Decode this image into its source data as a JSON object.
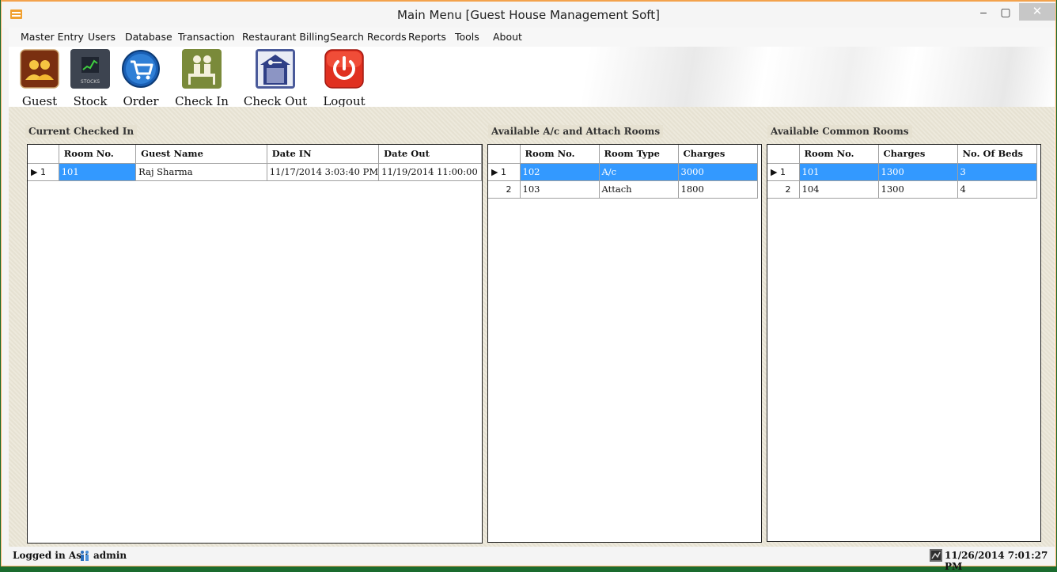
{
  "window": {
    "title": "Main Menu [Guest House Management Soft]",
    "controls": {
      "minimize": "‒",
      "maximize": "▢",
      "close": "✕"
    }
  },
  "menu": [
    "Master Entry",
    "Users",
    "Database",
    "Transaction",
    "Restaurant Billing",
    "Search Records",
    "Reports",
    "Tools",
    "About"
  ],
  "toolbar": {
    "guest": "Guest",
    "stock": "Stock",
    "stock_icon_text": "STOCKS",
    "order": "Order",
    "check_in": "Check In",
    "check_out": "Check Out",
    "logout": "Logout"
  },
  "checked_in": {
    "label": "Current Checked In",
    "columns": [
      "Room No.",
      "Guest Name",
      "Date IN",
      "Date Out"
    ],
    "rows": [
      {
        "num": "1",
        "marker": "▶",
        "cells": [
          "101",
          "Raj Sharma",
          "11/17/2014 3:03:40 PM",
          "11/19/2014 11:00:00"
        ]
      }
    ]
  },
  "ac_rooms": {
    "label": "Available A/c and Attach Rooms",
    "columns": [
      "Room No.",
      "Room Type",
      "Charges"
    ],
    "rows": [
      {
        "num": "1",
        "marker": "▶",
        "cells": [
          "102",
          "A/c",
          "3000"
        ]
      },
      {
        "num": "2",
        "marker": "",
        "cells": [
          "103",
          "Attach",
          "1800"
        ]
      }
    ]
  },
  "common_rooms": {
    "label": "Available Common Rooms",
    "columns": [
      "Room No.",
      "Charges",
      "No. Of Beds"
    ],
    "rows": [
      {
        "num": "1",
        "marker": "▶",
        "cells": [
          "101",
          "1300",
          "3"
        ]
      },
      {
        "num": "2",
        "marker": "",
        "cells": [
          "104",
          "1300",
          "4"
        ]
      }
    ]
  },
  "status": {
    "logged_label": "Logged in As :",
    "user": "admin",
    "datetime": "11/26/2014 7:01:27 PM"
  },
  "colors": {
    "selection": "#3399ff",
    "background": "#ebe6d7"
  }
}
